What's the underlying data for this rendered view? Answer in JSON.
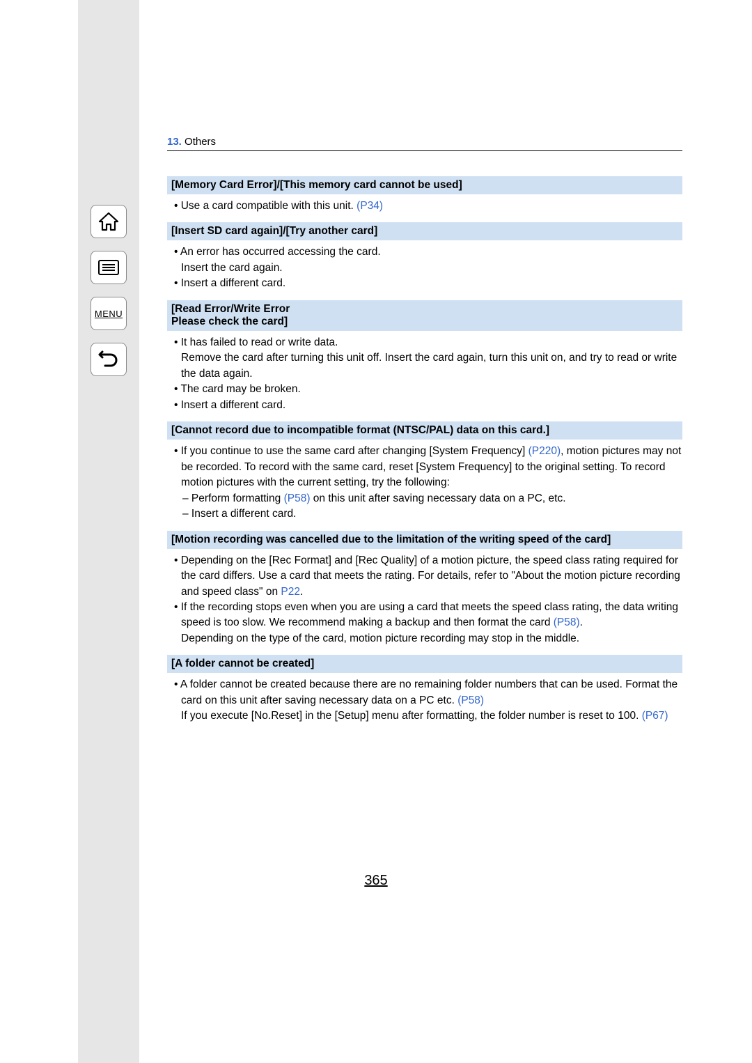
{
  "chapter": {
    "num": "13.",
    "title": "Others"
  },
  "nav": {
    "menu_label": "MENU"
  },
  "sections": [
    {
      "header": "[Memory Card Error]/[This memory card cannot be used]",
      "items": [
        {
          "type": "bullet",
          "text_pre": "• Use a card compatible with this unit. ",
          "link": "(P34)",
          "text_post": ""
        }
      ]
    },
    {
      "header": "[Insert SD card again]/[Try another card]",
      "items": [
        {
          "type": "bullet",
          "text_pre": "• An error has occurred accessing the card.",
          "link": "",
          "text_post": ""
        },
        {
          "type": "plain",
          "text_pre": "Insert the card again.",
          "link": "",
          "text_post": ""
        },
        {
          "type": "bullet",
          "text_pre": "• Insert a different card.",
          "link": "",
          "text_post": ""
        }
      ]
    },
    {
      "header": "[Read Error/Write Error\nPlease check the card]",
      "items": [
        {
          "type": "bullet",
          "text_pre": "• It has failed to read or write data.",
          "link": "",
          "text_post": ""
        },
        {
          "type": "plain",
          "text_pre": "Remove the card after turning this unit off. Insert the card again, turn this unit on, and try to read or write the data again.",
          "link": "",
          "text_post": ""
        },
        {
          "type": "bullet",
          "text_pre": "• The card may be broken.",
          "link": "",
          "text_post": ""
        },
        {
          "type": "bullet",
          "text_pre": "• Insert a different card.",
          "link": "",
          "text_post": ""
        }
      ]
    },
    {
      "header": "[Cannot record due to incompatible format (NTSC/PAL) data on this card.]",
      "items": [
        {
          "type": "bullet",
          "text_pre": "• If you continue to use the same card after changing [System Frequency] ",
          "link": "(P220)",
          "text_post": ", motion pictures may not be recorded. To record with the same card, reset [System Frequency] to the original setting. To record motion pictures with the current setting, try the following:"
        },
        {
          "type": "subbullet",
          "text_pre": "– Perform formatting ",
          "link": "(P58)",
          "text_post": " on this unit after saving necessary data on a PC, etc."
        },
        {
          "type": "subbullet",
          "text_pre": "– Insert a different card.",
          "link": "",
          "text_post": ""
        }
      ]
    },
    {
      "header": "[Motion recording was cancelled due to the limitation of the writing speed of the card]",
      "items": [
        {
          "type": "bullet",
          "text_pre": "• Depending on the [Rec Format] and [Rec Quality] of a motion picture, the speed class rating required for the card differs. Use a card that meets the rating. For details, refer to \"About the motion picture recording and speed class\" on ",
          "link": "P22",
          "text_post": "."
        },
        {
          "type": "bullet",
          "text_pre": "• If the recording stops even when you are using a card that meets the speed class rating, the data writing speed is too slow. We recommend making a backup and then format the card ",
          "link": "(P58)",
          "text_post": "."
        },
        {
          "type": "plain",
          "text_pre": "Depending on the type of the card, motion picture recording may stop in the middle.",
          "link": "",
          "text_post": ""
        }
      ]
    },
    {
      "header": "[A folder cannot be created]",
      "items": [
        {
          "type": "bullet",
          "text_pre": "• A folder cannot be created because there are no remaining folder numbers that can be used. Format the card on this unit after saving necessary data on a PC etc. ",
          "link": "(P58)",
          "text_post": ""
        },
        {
          "type": "plain",
          "text_pre": "If you execute [No.Reset] in the [Setup] menu after formatting, the folder number is reset to 100. ",
          "link": "(P67)",
          "text_post": ""
        }
      ]
    }
  ],
  "page_number": "365"
}
